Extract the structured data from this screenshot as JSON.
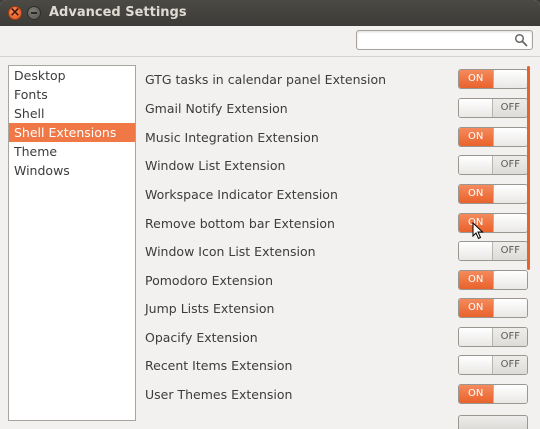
{
  "window": {
    "title": "Advanced Settings"
  },
  "search": {
    "value": "",
    "placeholder": ""
  },
  "sidebar": {
    "items": [
      {
        "label": "Desktop",
        "selected": false
      },
      {
        "label": "Fonts",
        "selected": false
      },
      {
        "label": "Shell",
        "selected": false
      },
      {
        "label": "Shell Extensions",
        "selected": true
      },
      {
        "label": "Theme",
        "selected": false
      },
      {
        "label": "Windows",
        "selected": false
      }
    ]
  },
  "extensions": [
    {
      "label": "GTG tasks in calendar panel Extension",
      "state": true
    },
    {
      "label": "Gmail Notify Extension",
      "state": false
    },
    {
      "label": "Music Integration Extension",
      "state": true
    },
    {
      "label": "Window List Extension",
      "state": false
    },
    {
      "label": "Workspace Indicator Extension",
      "state": true
    },
    {
      "label": "Remove bottom bar Extension",
      "state": true
    },
    {
      "label": "Window Icon List Extension",
      "state": false
    },
    {
      "label": "Pomodoro Extension",
      "state": true
    },
    {
      "label": "Jump Lists Extension",
      "state": true
    },
    {
      "label": "Opacify Extension",
      "state": false
    },
    {
      "label": "Recent Items Extension",
      "state": false
    },
    {
      "label": "User Themes Extension",
      "state": true
    }
  ],
  "switch_labels": {
    "on": "ON",
    "off": "OFF"
  },
  "colors": {
    "accent": "#e9622c",
    "selection": "#f07746",
    "titlebar": "#3c3b37"
  }
}
